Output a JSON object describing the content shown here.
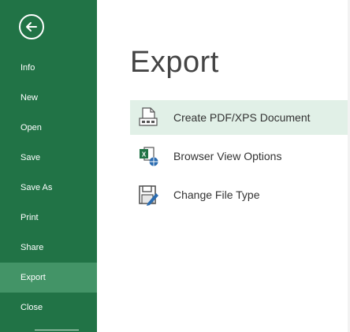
{
  "sidebar": {
    "back_icon": "back-arrow-icon",
    "items": [
      {
        "label": "Info"
      },
      {
        "label": "New"
      },
      {
        "label": "Open"
      },
      {
        "label": "Save"
      },
      {
        "label": "Save As"
      },
      {
        "label": "Print"
      },
      {
        "label": "Share"
      },
      {
        "label": "Export",
        "active": true
      },
      {
        "label": "Close"
      }
    ]
  },
  "main": {
    "title": "Export",
    "options": [
      {
        "label": "Create PDF/XPS Document",
        "icon": "pdf-document-icon",
        "selected": true
      },
      {
        "label": "Browser View Options",
        "icon": "excel-globe-icon"
      },
      {
        "label": "Change File Type",
        "icon": "change-file-type-icon"
      }
    ]
  },
  "colors": {
    "sidebar_bg": "#217346",
    "active_item_bg": "#439467",
    "selected_option_bg": "#e1f0e7",
    "title_color": "#444444"
  }
}
